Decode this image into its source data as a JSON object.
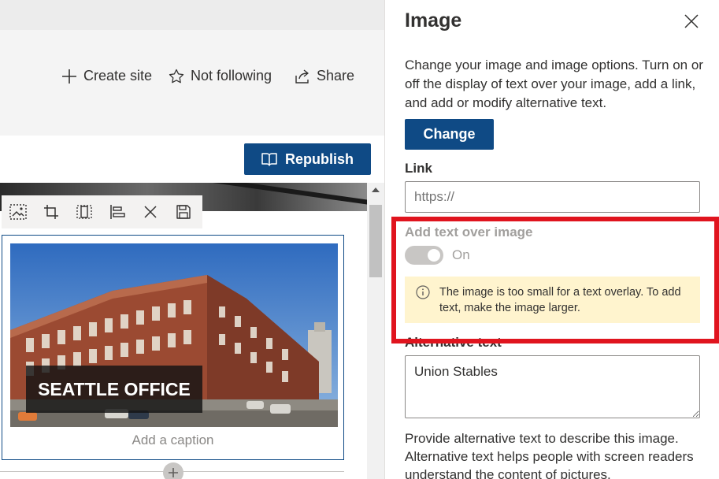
{
  "command_bar": {
    "create_site": "Create site",
    "not_following": "Not following",
    "share": "Share"
  },
  "edit_bar": {
    "republish": "Republish"
  },
  "image_toolbar": {
    "icons": [
      "image-icon",
      "crop-icon",
      "resize-icon",
      "align-left-icon",
      "close-icon",
      "save-icon"
    ]
  },
  "web_part": {
    "overlay_text": "SEATTLE OFFICE",
    "caption_placeholder": "Add a caption"
  },
  "pane": {
    "title": "Image",
    "description": "Change your image and image options. Turn on or off the display of text over your image, add a link, and add or modify alternative text.",
    "change_button": "Change",
    "link_label": "Link",
    "link_placeholder": "https://",
    "text_over_image_label": "Add text over image",
    "toggle_state": "On",
    "warning": "The image is too small for a text overlay. To add text, make the image larger.",
    "alt_text_label": "Alternative text",
    "alt_text_value": "Union Stables",
    "alt_help": "Provide alternative text to describe this image. Alternative text helps people with screen readers understand the content of pictures."
  },
  "colors": {
    "primary": "#0f4a85",
    "highlight": "#e0141e",
    "warning_bg": "#fff4ce"
  }
}
